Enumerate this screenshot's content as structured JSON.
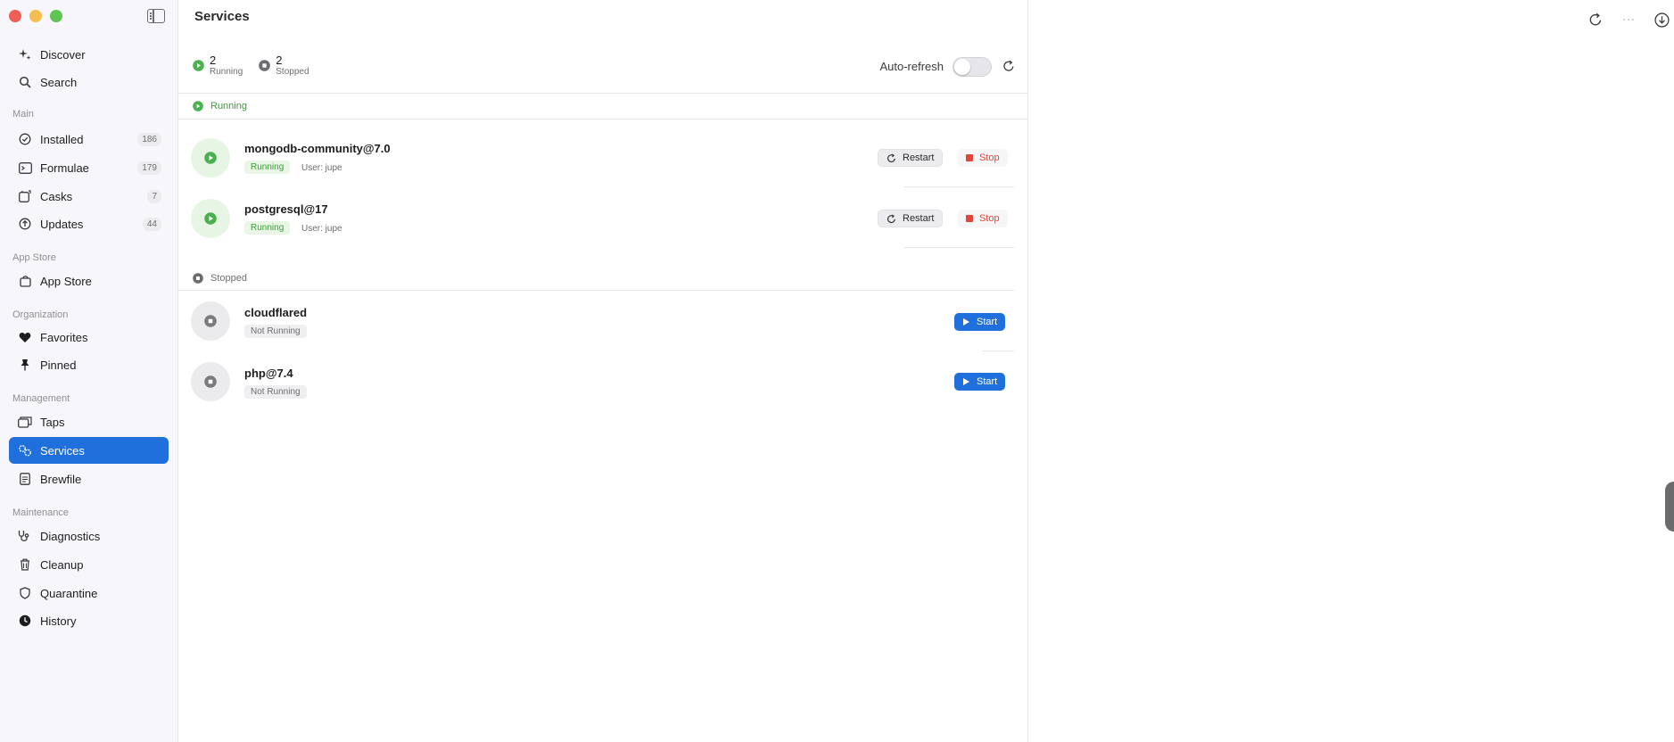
{
  "window": {
    "title": "Services"
  },
  "sidebar": {
    "top_items": [
      {
        "label": "Discover",
        "icon": "sparkle-icon"
      },
      {
        "label": "Search",
        "icon": "search-icon"
      }
    ],
    "sections": [
      {
        "title": "Main",
        "items": [
          {
            "label": "Installed",
            "badge": "186",
            "icon": "checkmark-circle-icon"
          },
          {
            "label": "Formulae",
            "badge": "179",
            "icon": "terminal-window-icon"
          },
          {
            "label": "Casks",
            "badge": "7",
            "icon": "app-window-icon"
          },
          {
            "label": "Updates",
            "badge": "44",
            "icon": "arrow-up-circle-icon"
          }
        ]
      },
      {
        "title": "App Store",
        "items": [
          {
            "label": "App Store",
            "icon": "bag-icon"
          }
        ]
      },
      {
        "title": "Organization",
        "items": [
          {
            "label": "Favorites",
            "icon": "heart-icon"
          },
          {
            "label": "Pinned",
            "icon": "pin-icon"
          }
        ]
      },
      {
        "title": "Management",
        "items": [
          {
            "label": "Taps",
            "icon": "taps-icon"
          },
          {
            "label": "Services",
            "icon": "gears-icon",
            "active": true
          },
          {
            "label": "Brewfile",
            "icon": "document-icon"
          }
        ]
      },
      {
        "title": "Maintenance",
        "items": [
          {
            "label": "Diagnostics",
            "icon": "stethoscope-icon"
          },
          {
            "label": "Cleanup",
            "icon": "trash-icon"
          },
          {
            "label": "Quarantine",
            "icon": "shield-icon"
          },
          {
            "label": "History",
            "icon": "clock-icon"
          }
        ]
      }
    ]
  },
  "summary": {
    "running_count": "2",
    "running_label": "Running",
    "stopped_count": "2",
    "stopped_label": "Stopped",
    "autorefresh_label": "Auto-refresh",
    "autorefresh_on": false
  },
  "groups": {
    "running": {
      "title": "Running",
      "services": [
        {
          "name": "mongodb-community@7.0",
          "status": "Running",
          "user": "User: jupe",
          "restart_label": "Restart",
          "stop_label": "Stop"
        },
        {
          "name": "postgresql@17",
          "status": "Running",
          "user": "User: jupe",
          "restart_label": "Restart",
          "stop_label": "Stop"
        }
      ]
    },
    "stopped": {
      "title": "Stopped",
      "services": [
        {
          "name": "cloudflared",
          "status": "Not Running",
          "start_label": "Start"
        },
        {
          "name": "php@7.4",
          "status": "Not Running",
          "start_label": "Start"
        }
      ]
    }
  },
  "colors": {
    "accent": "#1f6fdc",
    "running_green": "#3c9c3a",
    "stop_red": "#e0463b"
  },
  "toolbar_icons": [
    "refresh-icon",
    "more-icon",
    "download-icon"
  ]
}
